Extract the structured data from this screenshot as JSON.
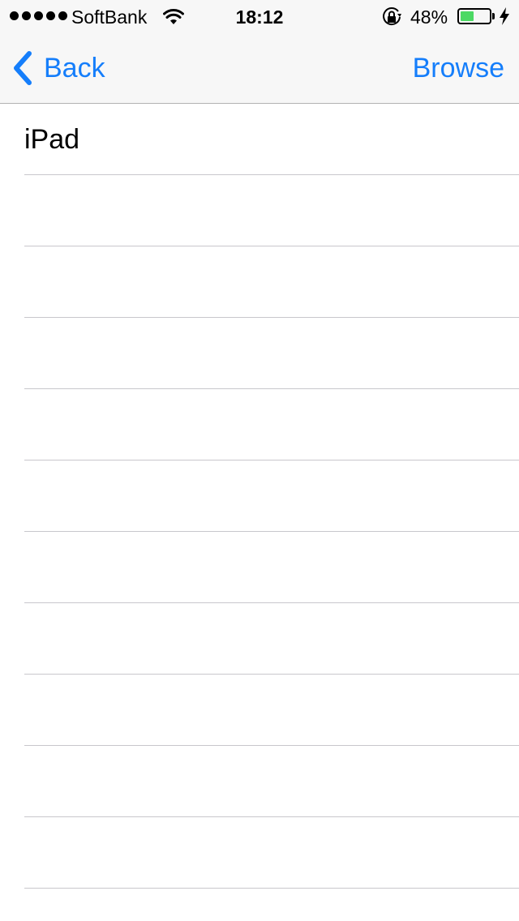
{
  "status_bar": {
    "carrier": "SoftBank",
    "time": "18:12",
    "battery_percent": "48%",
    "battery_level": 0.48,
    "battery_color": "#4cd964",
    "icons": [
      "signal-dots-icon",
      "wifi-icon",
      "orientation-lock-icon",
      "battery-icon",
      "charging-bolt-icon"
    ]
  },
  "nav": {
    "back_label": "Back",
    "right_label": "Browse",
    "tint_color": "#157efb"
  },
  "list": {
    "rows": [
      {
        "label": "iPad"
      },
      {
        "label": ""
      },
      {
        "label": ""
      },
      {
        "label": ""
      },
      {
        "label": ""
      },
      {
        "label": ""
      },
      {
        "label": ""
      },
      {
        "label": ""
      },
      {
        "label": ""
      },
      {
        "label": ""
      },
      {
        "label": ""
      }
    ]
  }
}
